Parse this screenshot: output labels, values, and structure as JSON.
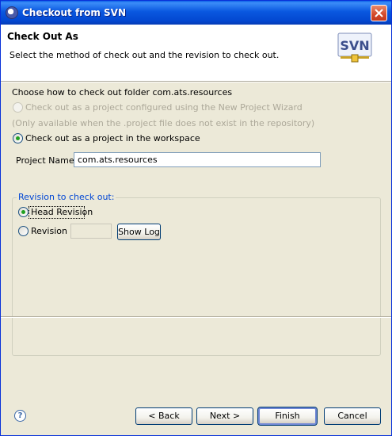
{
  "window": {
    "title": "Checkout from SVN",
    "icon": "eclipse-icon"
  },
  "header": {
    "title": "Check Out As",
    "description": "Select the method of check out and the revision to check out.",
    "logo_text": "SVN"
  },
  "checkout": {
    "prompt": "Choose how to check out folder com.ats.resources",
    "option_wizard": "Check out as a project configured using the New Project Wizard",
    "option_wizard_note": "(Only available when the .project file does not exist in the repository)",
    "option_workspace": "Check out as a project in the workspace",
    "selected_option": "workspace",
    "project_name_label": "Project Name:",
    "project_name_value": "com.ats.resources"
  },
  "revision": {
    "group_label": "Revision to check out:",
    "head_revision_label": "Head Revision",
    "revision_label": "Revision",
    "revision_value": "",
    "show_log_label": "Show Log",
    "selected": "head"
  },
  "buttons": {
    "back": "< Back",
    "next": "Next >",
    "finish": "Finish",
    "cancel": "Cancel"
  },
  "colors": {
    "title_bar": "#0a58e0",
    "group_label": "#0046d5",
    "radio_dot": "#21a121"
  }
}
